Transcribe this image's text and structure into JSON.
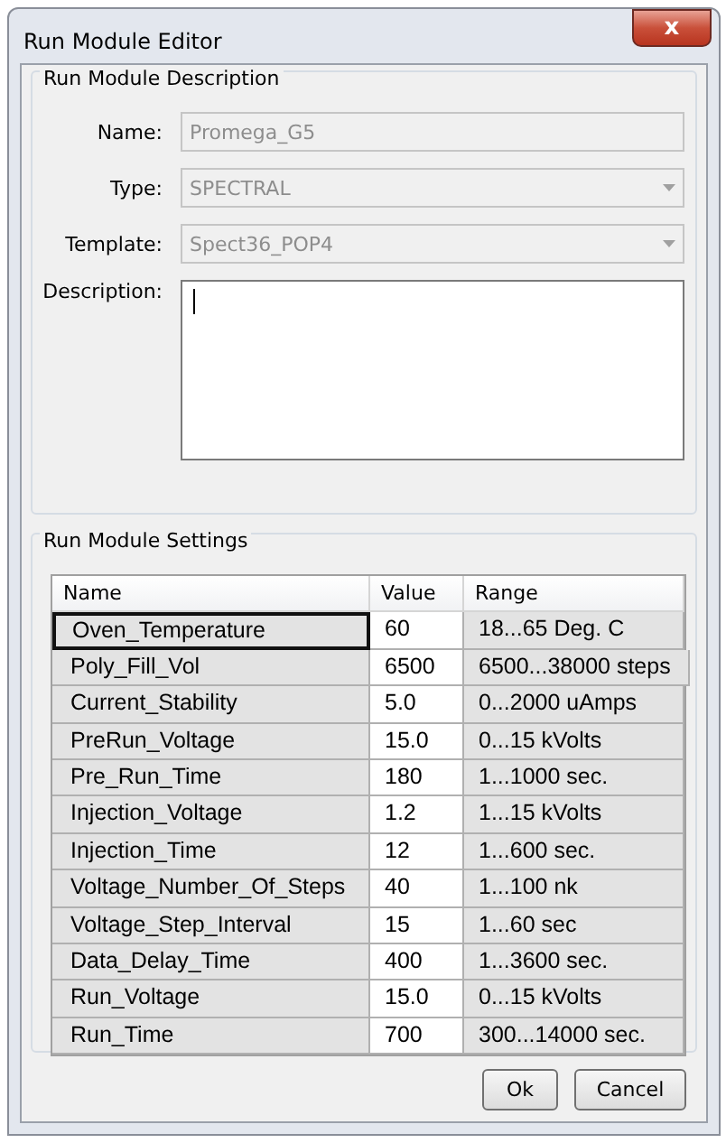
{
  "window": {
    "title": "Run Module Editor",
    "close": "x"
  },
  "description_group": {
    "title": "Run Module Description",
    "fields": [
      {
        "kind": "text",
        "label": "Name:",
        "value": "Promega_G5",
        "disabled": true
      },
      {
        "kind": "dropdown",
        "label": "Type:",
        "value": "SPECTRAL",
        "disabled": true
      },
      {
        "kind": "dropdown",
        "label": "Template:",
        "value": "Spect36_POP4",
        "disabled": true
      },
      {
        "kind": "textarea",
        "label": "Description:",
        "focused": true,
        "disabled": false
      }
    ]
  },
  "settings_group": {
    "title": "Run Module Settings",
    "table": {
      "columns": [
        "Name",
        "Value",
        "Range"
      ],
      "rows": [
        {
          "name": "Oven_Temperature",
          "value": "60",
          "range": "18...65 Deg. C",
          "selected": true
        },
        {
          "name": "Poly_Fill_Vol",
          "value": "6500",
          "range": "6500...38000 steps",
          "selected": false
        },
        {
          "name": "Current_Stability",
          "value": "5.0",
          "range": "0...2000 uAmps",
          "selected": false
        },
        {
          "name": "PreRun_Voltage",
          "value": "15.0",
          "range": "0...15 kVolts",
          "selected": false
        },
        {
          "name": "Pre_Run_Time",
          "value": "180",
          "range": "1...1000 sec.",
          "selected": false
        },
        {
          "name": "Injection_Voltage",
          "value": "1.2",
          "range": "1...15 kVolts",
          "selected": false
        },
        {
          "name": "Injection_Time",
          "value": "12",
          "range": "1...600 sec.",
          "selected": false
        },
        {
          "name": "Voltage_Number_Of_Steps",
          "value": "40",
          "range": "1...100 nk",
          "selected": false
        },
        {
          "name": "Voltage_Step_Interval",
          "value": "15",
          "range": "1...60 sec",
          "selected": false
        },
        {
          "name": "Data_Delay_Time",
          "value": "400",
          "range": "1...3600 sec.",
          "selected": false
        },
        {
          "name": "Run_Voltage",
          "value": "15.0",
          "range": "0...15 kVolts",
          "selected": false
        },
        {
          "name": "Run_Time",
          "value": "700",
          "range": "300...14000 sec.",
          "selected": false
        }
      ]
    }
  },
  "buttons": [
    "Ok",
    "Cancel"
  ]
}
